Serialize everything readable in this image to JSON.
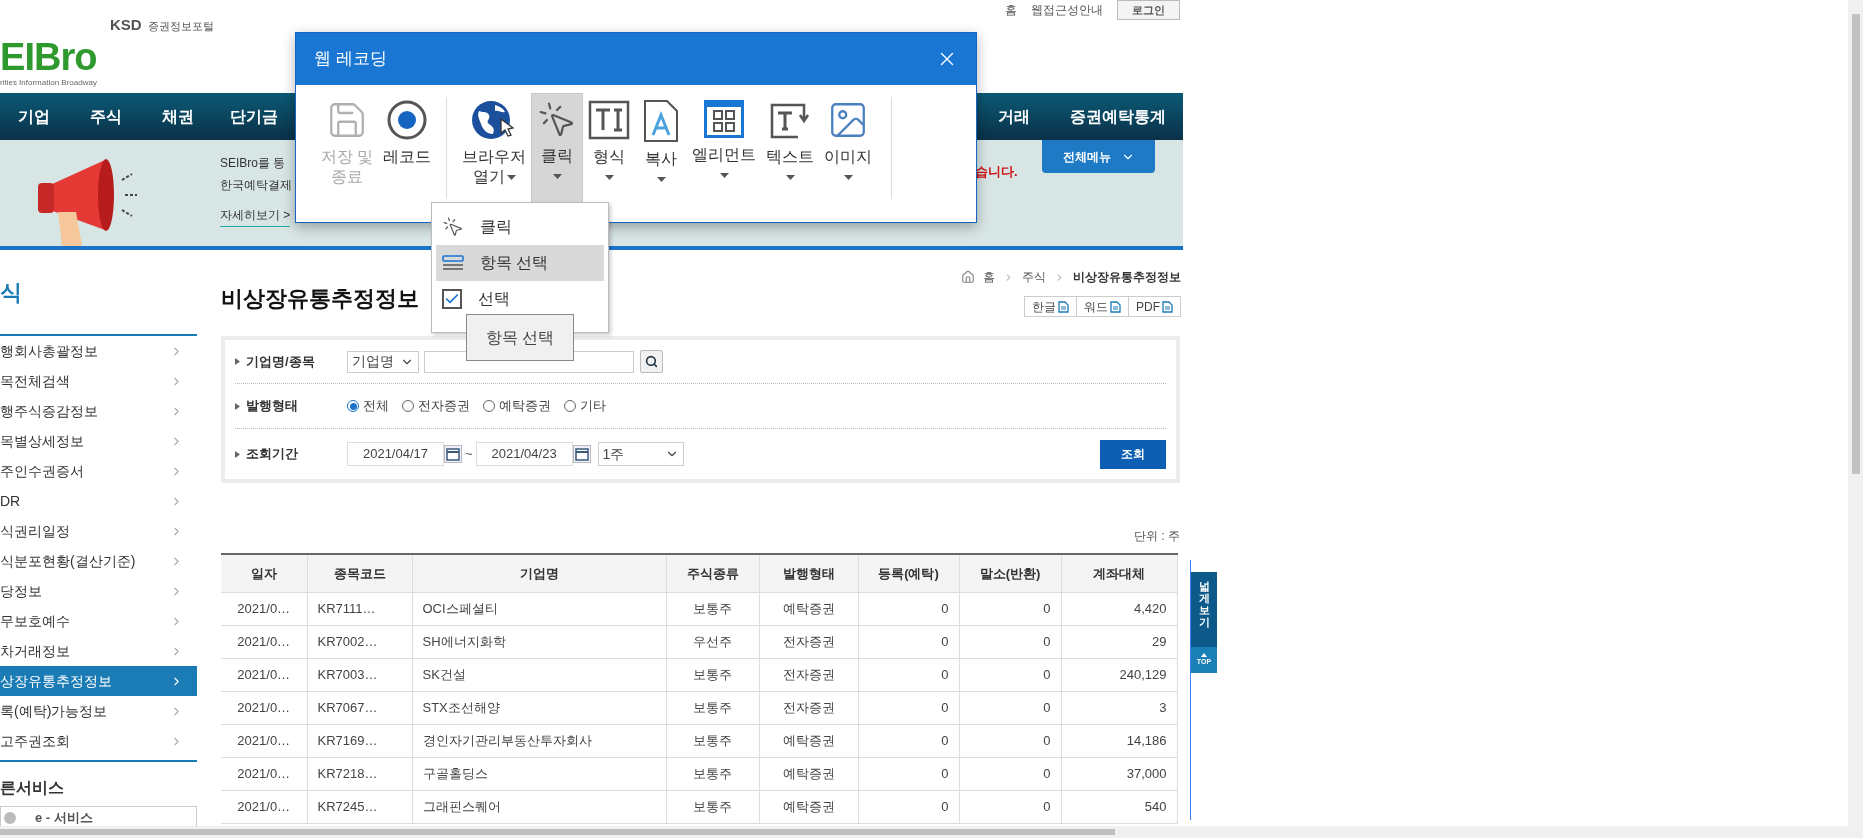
{
  "header": {
    "top_links": [
      "홈",
      "웹접근성안내"
    ],
    "login_button": "로그인",
    "logo": {
      "brand": "KSD",
      "portal": "증권정보포털",
      "name": "EIBro",
      "tagline": "rities Information Broadway"
    }
  },
  "nav": [
    "기업",
    "주식",
    "채권",
    "단기금",
    "거래",
    "증권예탁통계"
  ],
  "banner": {
    "line_1": "SEIBro를 통",
    "line_2": "한국예탁결제",
    "link": "자세히보기 >",
    "notice": "습니다.",
    "menu_button": "전체메뉴"
  },
  "sidebar": {
    "title": "식",
    "items": [
      {
        "label": "행회사총괄정보",
        "selected": false
      },
      {
        "label": "목전체검색",
        "selected": false
      },
      {
        "label": "행주식증감정보",
        "selected": false
      },
      {
        "label": "목별상세정보",
        "selected": false
      },
      {
        "label": "주인수권증서",
        "selected": false
      },
      {
        "label": "DR",
        "selected": false
      },
      {
        "label": "식권리일정",
        "selected": false
      },
      {
        "label": "식분포현황(결산기준)",
        "selected": false
      },
      {
        "label": "당정보",
        "selected": false
      },
      {
        "label": "무보호예수",
        "selected": false
      },
      {
        "label": "차거래정보",
        "selected": false
      },
      {
        "label": "상장유통추정정보",
        "selected": true
      },
      {
        "label": "록(예탁)가능정보",
        "selected": false
      },
      {
        "label": "고주권조회",
        "selected": false
      }
    ],
    "services_title": "른서비스",
    "service": "e - 서비스"
  },
  "page": {
    "title": "비상장유통추정정보",
    "breadcrumb": [
      "홈",
      "주식",
      "비상장유통추정정보"
    ],
    "export_buttons": [
      "한글",
      "워드",
      "PDF"
    ]
  },
  "search": {
    "company_label": "기업명/종목",
    "company_select": "기업명",
    "issue_label": "발행형태",
    "issue_options": [
      {
        "label": "전체",
        "selected": true
      },
      {
        "label": "전자증권",
        "selected": false
      },
      {
        "label": "예탁증권",
        "selected": false
      },
      {
        "label": "기타",
        "selected": false
      }
    ],
    "period_label": "조회기간",
    "date_from": "2021/04/17",
    "date_separator": "~",
    "date_to": "2021/04/23",
    "period_select": "1주",
    "submit_button": "조회"
  },
  "unit": "단위 : 주",
  "table": {
    "columns": [
      "일자",
      "종목코드",
      "기업명",
      "주식종류",
      "발행형태",
      "등록(예탁)",
      "말소(반환)",
      "계좌대체"
    ],
    "rows": [
      [
        "2021/0…",
        "KR7111…",
        "OCI스페셜티",
        "보통주",
        "예탁증권",
        "0",
        "0",
        "4,420"
      ],
      [
        "2021/0…",
        "KR7002…",
        "SH에너지화학",
        "우선주",
        "전자증권",
        "0",
        "0",
        "29"
      ],
      [
        "2021/0…",
        "KR7003…",
        "SK건설",
        "보통주",
        "전자증권",
        "0",
        "0",
        "240,129"
      ],
      [
        "2021/0…",
        "KR7067…",
        "STX조선해양",
        "보통주",
        "전자증권",
        "0",
        "0",
        "3"
      ],
      [
        "2021/0…",
        "KR7169…",
        "경인자기관리부동산투자회사",
        "보통주",
        "예탁증권",
        "0",
        "0",
        "14,186"
      ],
      [
        "2021/0…",
        "KR7218…",
        "구골홀딩스",
        "보통주",
        "예탁증권",
        "0",
        "0",
        "37,000"
      ],
      [
        "2021/0…",
        "KR7245…",
        "그래핀스퀘어",
        "보통주",
        "예탁증권",
        "0",
        "0",
        "540"
      ]
    ]
  },
  "side_tab": {
    "wide_view": "넓게보기",
    "top": "TOP"
  },
  "recorder": {
    "title": "웹 레코딩",
    "tools": [
      {
        "lines": [
          "저장 및",
          "종료"
        ],
        "dropdown": false,
        "disabled": true,
        "selected": false
      },
      {
        "lines": [
          "레코드"
        ],
        "dropdown": false,
        "disabled": false,
        "selected": false
      },
      {
        "lines": [
          "브라우저",
          "열기"
        ],
        "dropdown": true,
        "disabled": false,
        "selected": false
      },
      {
        "lines": [
          "클릭"
        ],
        "dropdown": true,
        "disabled": false,
        "selected": true
      },
      {
        "lines": [
          "형식"
        ],
        "dropdown": true,
        "disabled": false,
        "selected": false
      },
      {
        "lines": [
          "복사"
        ],
        "dropdown": true,
        "disabled": false,
        "selected": false
      },
      {
        "lines": [
          "엘리먼트"
        ],
        "dropdown": true,
        "disabled": false,
        "selected": false
      },
      {
        "lines": [
          "텍스트"
        ],
        "dropdown": true,
        "disabled": false,
        "selected": false
      },
      {
        "lines": [
          "이미지"
        ],
        "dropdown": true,
        "disabled": false,
        "selected": false
      }
    ],
    "menu": [
      {
        "kind": "click",
        "label": "클릭",
        "selected": false
      },
      {
        "kind": "item",
        "label": "항목 선택",
        "selected": true
      },
      {
        "kind": "check",
        "label": "선택",
        "selected": false,
        "checked": true
      }
    ],
    "tooltip": "항목 선택"
  }
}
